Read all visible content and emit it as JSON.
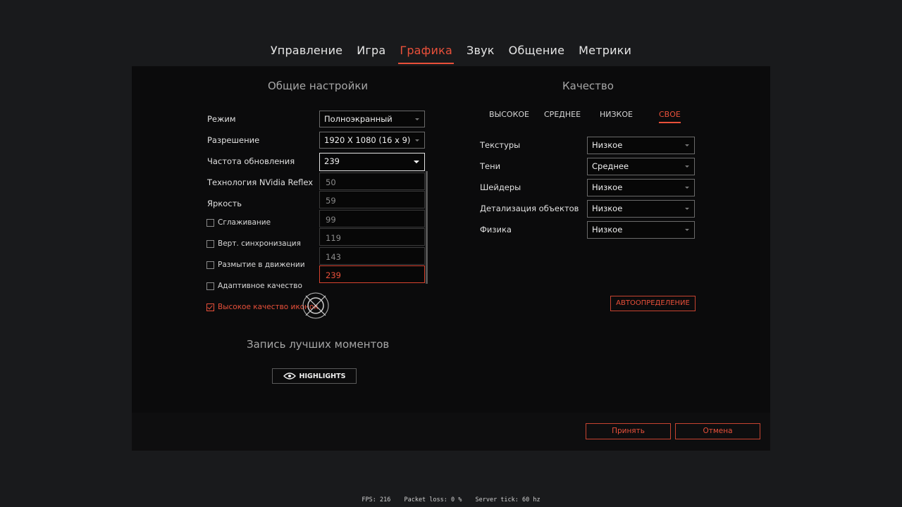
{
  "tabs": [
    {
      "label": "Управление",
      "active": false
    },
    {
      "label": "Игра",
      "active": false
    },
    {
      "label": "Графика",
      "active": true
    },
    {
      "label": "Звук",
      "active": false
    },
    {
      "label": "Общение",
      "active": false
    },
    {
      "label": "Метрики",
      "active": false
    }
  ],
  "general": {
    "title": "Общие настройки",
    "mode": {
      "label": "Режим",
      "value": "Полноэкранный"
    },
    "resolution": {
      "label": "Разрешение",
      "value": "1920 X 1080 (16 x 9)"
    },
    "refresh": {
      "label": "Частота обновления",
      "value": "239"
    },
    "reflex": {
      "label": "Технология NVidia Reflex"
    },
    "brightness": {
      "label": "Яркость"
    },
    "refresh_options": [
      "50",
      "59",
      "99",
      "119",
      "143",
      "239"
    ],
    "refresh_selected": "239",
    "checkboxes": [
      {
        "label": "Сглаживание",
        "checked": false
      },
      {
        "label": "Верт. синхронизация",
        "checked": false
      },
      {
        "label": "Размытие в движении",
        "checked": false
      },
      {
        "label": "Адаптивное качество",
        "checked": false
      },
      {
        "label": "Высокое качество иконок",
        "checked": true
      }
    ]
  },
  "highlights": {
    "title": "Запись лучших моментов",
    "button": "HIGHLIGHTS"
  },
  "quality": {
    "title": "Качество",
    "presets": [
      {
        "label": "ВЫСОКОЕ",
        "active": false
      },
      {
        "label": "СРЕДНЕЕ",
        "active": false
      },
      {
        "label": "НИЗКОЕ",
        "active": false
      },
      {
        "label": "СВОЕ",
        "active": true
      }
    ],
    "rows": [
      {
        "label": "Текстуры",
        "value": "Низкое"
      },
      {
        "label": "Тени",
        "value": "Среднее"
      },
      {
        "label": "Шейдеры",
        "value": "Низкое"
      },
      {
        "label": "Детализация объектов",
        "value": "Низкое"
      },
      {
        "label": "Физика",
        "value": "Низкое"
      }
    ],
    "autodetect": "АВТООПРЕДЕЛЕНИЕ"
  },
  "footer": {
    "accept": "Принять",
    "cancel": "Отмена"
  },
  "status": {
    "fps": "FPS: 216",
    "packet_loss": "Packet loss: 0 %",
    "server_tick": "Server tick: 60 hz"
  },
  "colors": {
    "accent": "#e9503a",
    "panel": "#0b0b0c",
    "background": "#191a1c"
  }
}
